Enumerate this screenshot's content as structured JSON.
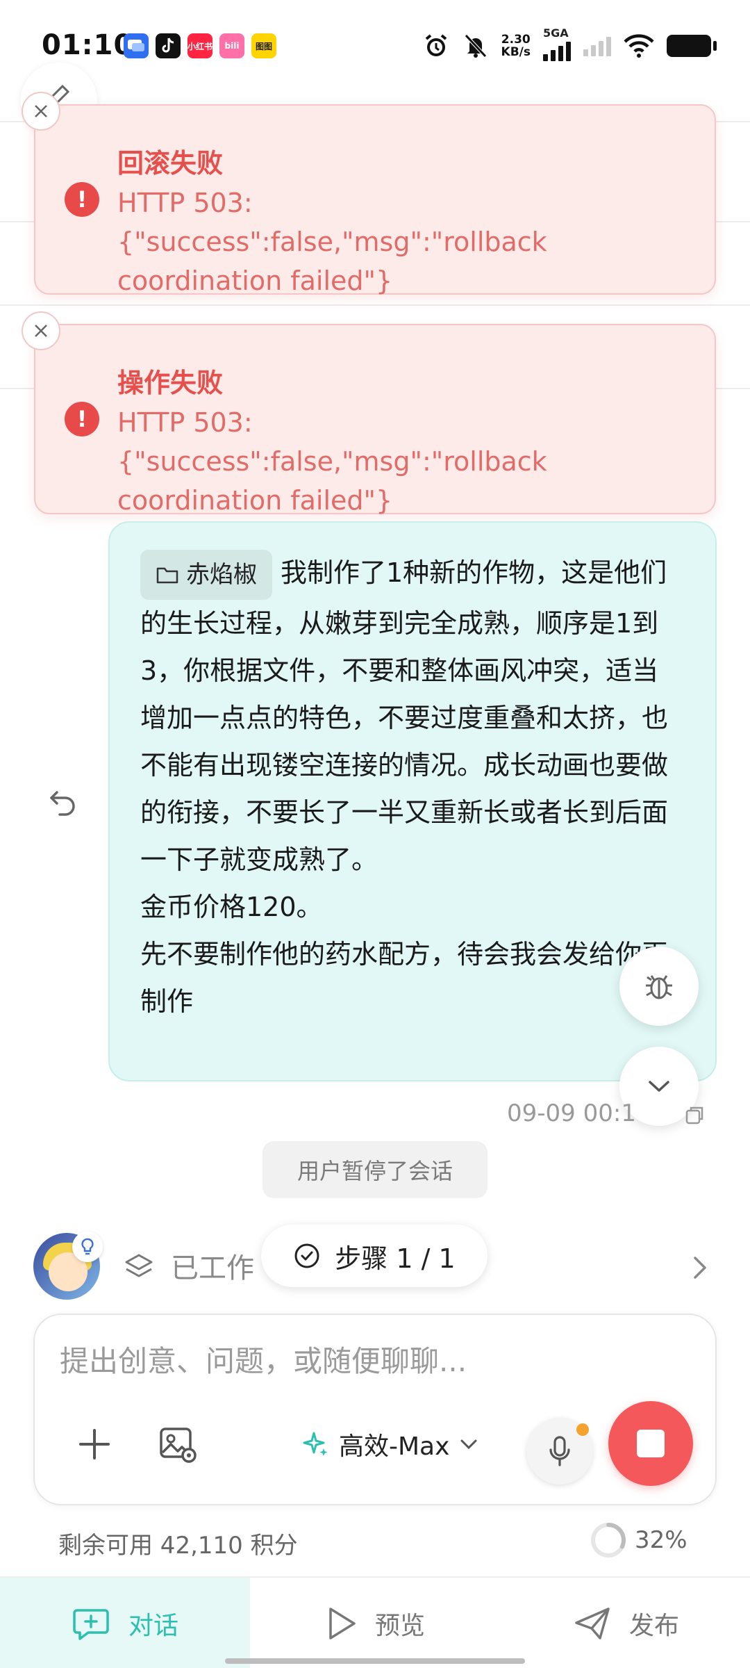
{
  "status_bar": {
    "time": "01:10",
    "net_speed_value": "2.30",
    "net_speed_unit": "KB/s",
    "network_type": "5GA",
    "app_icons": [
      "message-app-icon",
      "tiktok-icon",
      "xiaohongshu-icon",
      "bilibili-icon",
      "game-app-icon"
    ],
    "app_icon_labels": [
      "",
      "",
      "小红书",
      "bili",
      "图图"
    ]
  },
  "toasts": [
    {
      "title": "回滚失败",
      "message": "HTTP 503: {\"success\":false,\"msg\":\"rollback coordination failed\"}"
    },
    {
      "title": "操作失败",
      "message": "HTTP 503: {\"success\":false,\"msg\":\"rollback coordination failed\"}"
    }
  ],
  "message": {
    "folder_chip": "赤焰椒",
    "text": "我制作了1种新的作物，这是他们的生长过程，从嫩芽到完全成熟，顺序是1到3，你根据文件，不要和整体画风冲突，适当增加一点点的特色，不要过度重叠和太挤，也不能有出现镂空连接的情况。成长动画也要做的衔接，不要长了一半又重新长或者长到后面一下子就变成熟了。\n金币价格120。\n先不要制作他的药水配方，待会我会发给你再制作",
    "timestamp": "09-09 00:1"
  },
  "session": {
    "paused_text": "用户暂停了会话",
    "working_text": "已工作",
    "step_label": "步骤 1 / 1"
  },
  "composer": {
    "placeholder": "提出创意、问题，或随便聊聊...",
    "model": "高效-Max"
  },
  "footer": {
    "credits": "剩余可用 42,110 积分",
    "progress_text": "32%",
    "progress_value": 0.32
  },
  "nav": {
    "chat": "对话",
    "preview": "预览",
    "publish": "发布"
  },
  "colors": {
    "accent": "#2bbfb0",
    "error": "#e5504d",
    "stop": "#f4585b",
    "bubble": "#e1f8f6"
  }
}
